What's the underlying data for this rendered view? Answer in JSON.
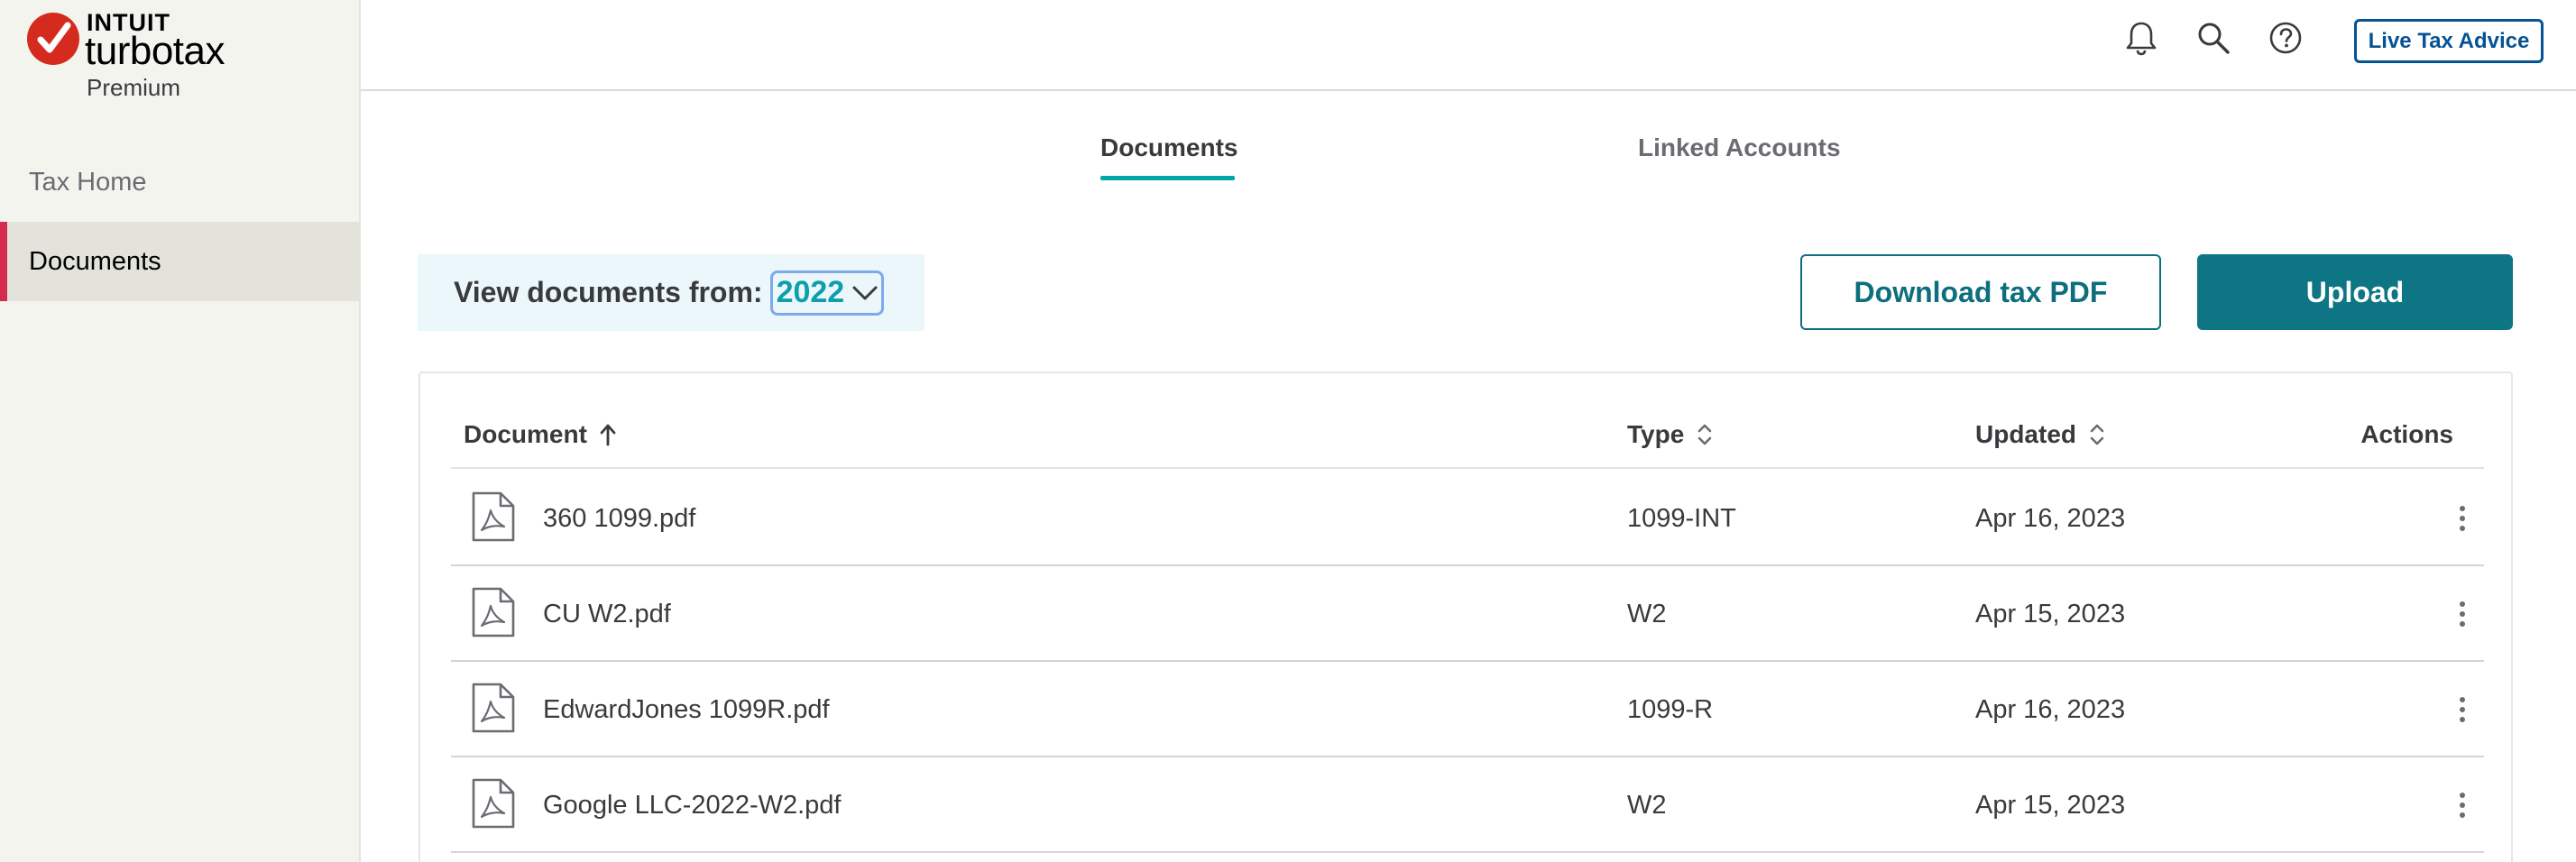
{
  "brand": {
    "company": "INTUIT",
    "product": "turbotax",
    "edition": "Premium",
    "accent_color": "#d52b1e"
  },
  "sidebar": {
    "items": [
      {
        "label": "Tax Home",
        "active": false
      },
      {
        "label": "Documents",
        "active": true
      }
    ]
  },
  "header": {
    "icons": [
      "bell-icon",
      "search-icon",
      "help-icon"
    ],
    "live_advice_label": "Live Tax Advice"
  },
  "tabs": [
    {
      "label": "Documents",
      "active": true
    },
    {
      "label": "Linked Accounts",
      "active": false
    }
  ],
  "filter": {
    "label": "View documents from:",
    "year": "2022"
  },
  "actions": {
    "download_label": "Download tax PDF",
    "upload_label": "Upload",
    "primary_color": "#0d7584"
  },
  "table": {
    "columns": {
      "document": "Document",
      "type": "Type",
      "updated": "Updated",
      "actions": "Actions"
    },
    "sort": {
      "column": "Document",
      "direction": "ascending"
    },
    "rows": [
      {
        "name": "360 1099.pdf",
        "type": "1099-INT",
        "updated": "Apr 16, 2023",
        "icon": "pdf-file-icon"
      },
      {
        "name": "CU W2.pdf",
        "type": "W2",
        "updated": "Apr 15, 2023",
        "icon": "pdf-file-icon"
      },
      {
        "name": "EdwardJones 1099R.pdf",
        "type": "1099-R",
        "updated": "Apr 16, 2023",
        "icon": "pdf-file-icon"
      },
      {
        "name": "Google LLC-2022-W2.pdf",
        "type": "W2",
        "updated": "Apr 15, 2023",
        "icon": "pdf-file-icon"
      }
    ]
  }
}
